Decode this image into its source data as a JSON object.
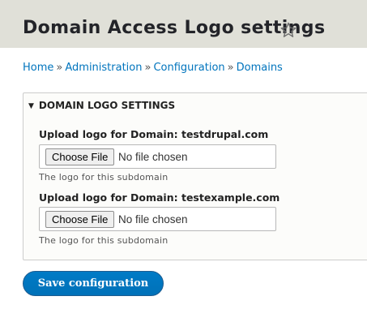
{
  "page": {
    "title": "Domain Access Logo settings",
    "star_icon": "star-outline-icon"
  },
  "breadcrumb": {
    "items": [
      "Home",
      "Administration",
      "Configuration",
      "Domains"
    ],
    "separator": "»"
  },
  "logo_settings": {
    "heading": "DOMAIN LOGO SETTINGS",
    "collapse_icon": "triangle-down-icon",
    "fields": [
      {
        "label": "Upload logo for Domain: testdrupal.com",
        "button_label": "Choose File",
        "status": "No file chosen",
        "description": "The logo for this subdomain"
      },
      {
        "label": "Upload logo for Domain: testexample.com",
        "button_label": "Choose File",
        "status": "No file chosen",
        "description": "The logo for this subdomain"
      }
    ]
  },
  "actions": {
    "save_label": "Save configuration"
  },
  "colors": {
    "header_bg": "#e0e0d8",
    "link": "#0074bd",
    "primary_button": "#0074bd"
  }
}
